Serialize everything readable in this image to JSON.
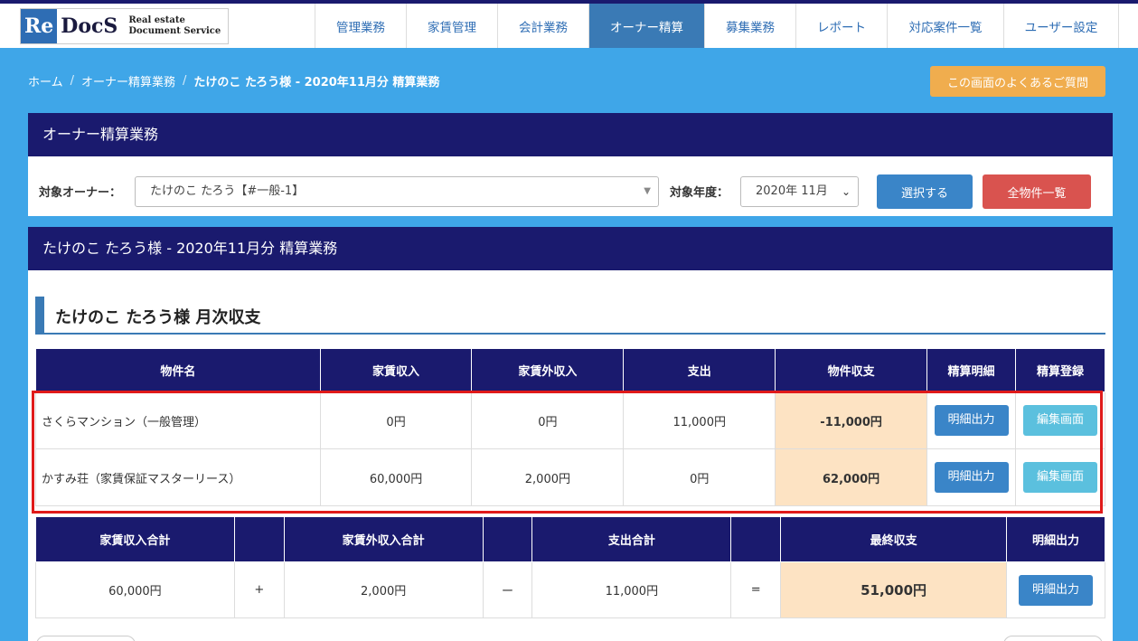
{
  "logo": {
    "re": "Re",
    "docs": "DocS",
    "sub1": "Real estate",
    "sub2": "Document Service"
  },
  "nav": [
    {
      "label": "管理業務"
    },
    {
      "label": "家賃管理"
    },
    {
      "label": "会計業務"
    },
    {
      "label": "オーナー精算",
      "active": true
    },
    {
      "label": "募集業務"
    },
    {
      "label": "レポート"
    },
    {
      "label": "対応案件一覧"
    },
    {
      "label": "ユーザー設定"
    }
  ],
  "breadcrumb": {
    "home": "ホーム",
    "sep": "/",
    "parent": "オーナー精算業務",
    "current": "たけのこ たろう様 - 2020年11月分 精算業務"
  },
  "faq_button": "この画面のよくあるご質問",
  "selector_panel": {
    "title": "オーナー精算業務",
    "owner_label": "対象オーナー：",
    "owner_value": "たけのこ たろう【#一般-1】",
    "year_label": "対象年度：",
    "year_value": "2020年 11月",
    "select_button": "選択する",
    "all_button": "全物件一覧"
  },
  "settlement_panel": {
    "title": "たけのこ たろう様 - 2020年11月分 精算業務",
    "section_title": "たけのこ たろう様 月次収支",
    "columns": [
      "物件名",
      "家賃収入",
      "家賃外収入",
      "支出",
      "物件収支",
      "精算明細",
      "精算登録"
    ],
    "rows": [
      {
        "name": "さくらマンション（一般管理）",
        "rent": "0円",
        "other": "0円",
        "expense": "11,000円",
        "balance": "-11,000円",
        "detail_btn": "明細出力",
        "edit_btn": "編集画面"
      },
      {
        "name": "かすみ荘（家賃保証マスターリース）",
        "rent": "60,000円",
        "other": "2,000円",
        "expense": "0円",
        "balance": "62,000円",
        "detail_btn": "明細出力",
        "edit_btn": "編集画面"
      }
    ],
    "totals": {
      "headers": [
        "家賃収入合計",
        "家賃外収入合計",
        "支出合計",
        "最終収支",
        "明細出力"
      ],
      "rent_total": "60,000円",
      "plus": "+",
      "other_total": "2,000円",
      "minus": "ー",
      "expense_total": "11,000円",
      "equals": "=",
      "final": "51,000円",
      "detail_btn": "明細出力"
    }
  },
  "colors": {
    "navy": "#1a1a6e",
    "background": "#3fa6e8",
    "accent": "#3a85c8",
    "orange": "#f0ad4e",
    "red": "#d9534f",
    "cyan": "#5bc0de",
    "peach": "#fde3c3",
    "highlight": "#e01a1a"
  }
}
